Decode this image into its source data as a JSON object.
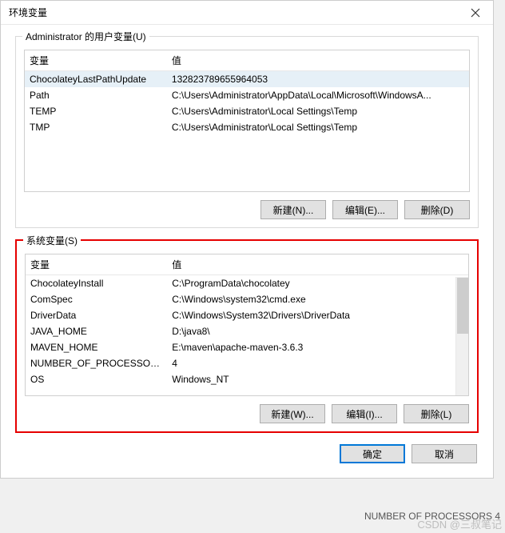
{
  "titlebar": {
    "title": "环境变量"
  },
  "user_vars": {
    "legend": "Administrator 的用户变量(U)",
    "columns": {
      "var": "变量",
      "val": "值"
    },
    "rows": [
      {
        "var": "ChocolateyLastPathUpdate",
        "val": "132823789655964053"
      },
      {
        "var": "Path",
        "val": "C:\\Users\\Administrator\\AppData\\Local\\Microsoft\\WindowsA..."
      },
      {
        "var": "TEMP",
        "val": "C:\\Users\\Administrator\\Local Settings\\Temp"
      },
      {
        "var": "TMP",
        "val": "C:\\Users\\Administrator\\Local Settings\\Temp"
      }
    ],
    "buttons": {
      "new": "新建(N)...",
      "edit": "编辑(E)...",
      "delete": "删除(D)"
    }
  },
  "sys_vars": {
    "legend": "系统变量(S)",
    "columns": {
      "var": "变量",
      "val": "值"
    },
    "rows": [
      {
        "var": "ChocolateyInstall",
        "val": "C:\\ProgramData\\chocolatey"
      },
      {
        "var": "ComSpec",
        "val": "C:\\Windows\\system32\\cmd.exe"
      },
      {
        "var": "DriverData",
        "val": "C:\\Windows\\System32\\Drivers\\DriverData"
      },
      {
        "var": "JAVA_HOME",
        "val": "D:\\java8\\"
      },
      {
        "var": "MAVEN_HOME",
        "val": "E:\\maven\\apache-maven-3.6.3"
      },
      {
        "var": "NUMBER_OF_PROCESSORS",
        "val": "4"
      },
      {
        "var": "OS",
        "val": "Windows_NT"
      }
    ],
    "buttons": {
      "new": "新建(W)...",
      "edit": "编辑(I)...",
      "delete": "删除(L)"
    }
  },
  "dialog_buttons": {
    "ok": "确定",
    "cancel": "取消"
  },
  "watermark": "CSDN @三叔笔记",
  "behind_text": "NUMBER OF PROCESSORS  4"
}
